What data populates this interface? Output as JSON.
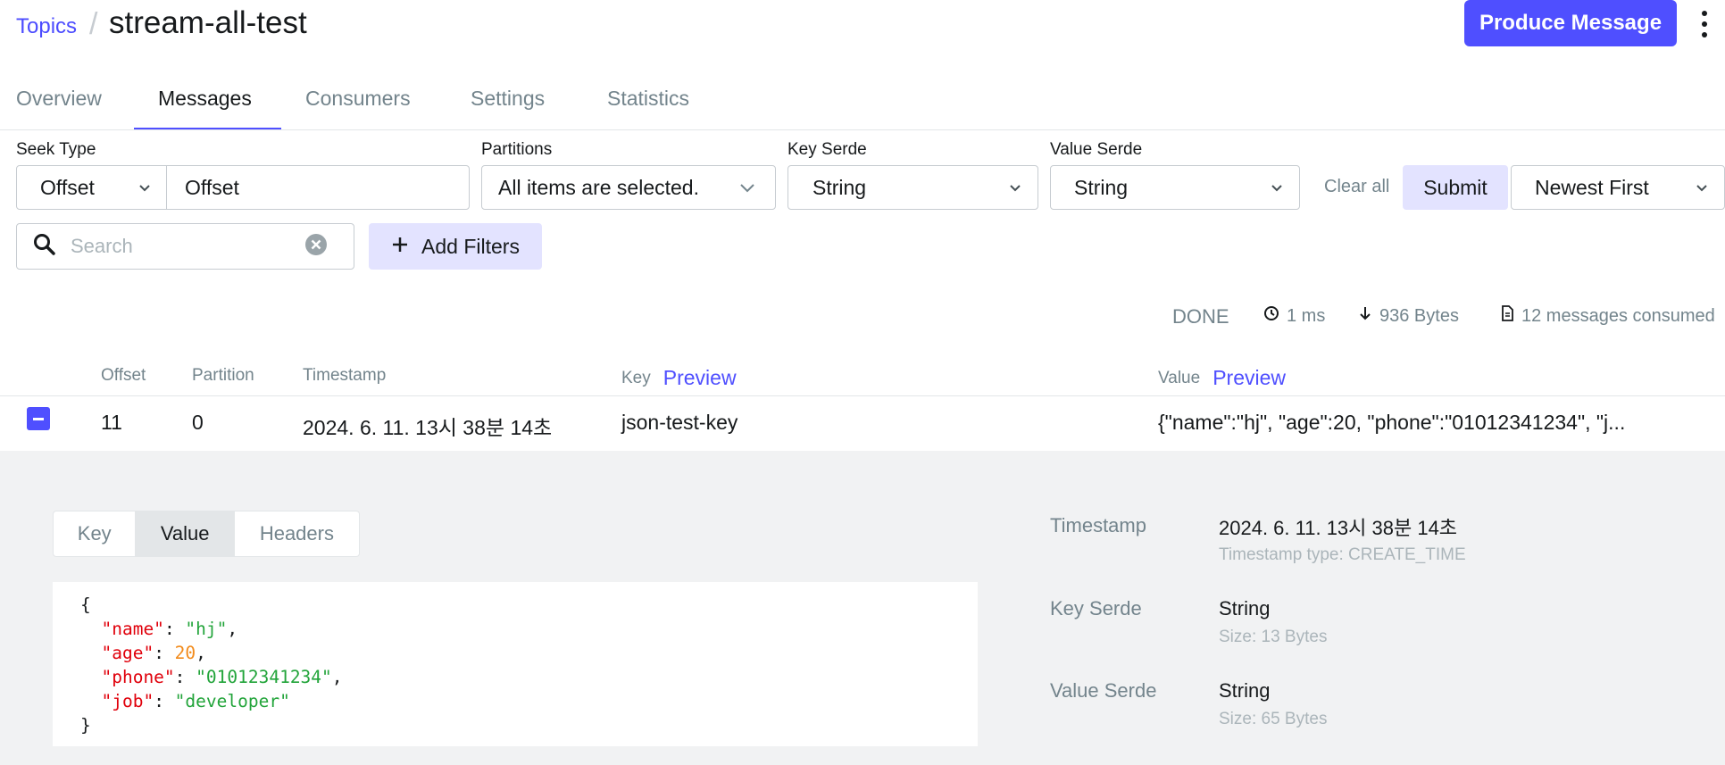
{
  "breadcrumb": {
    "parent": "Topics",
    "separator": "/",
    "title": "stream-all-test"
  },
  "header": {
    "produce_label": "Produce Message"
  },
  "tabs": [
    {
      "label": "Overview"
    },
    {
      "label": "Messages"
    },
    {
      "label": "Consumers"
    },
    {
      "label": "Settings"
    },
    {
      "label": "Statistics"
    }
  ],
  "active_tab": "Messages",
  "filters": {
    "seek_type_label": "Seek Type",
    "seek_type_value": "Offset",
    "seek_input_value": "Offset",
    "partitions_label": "Partitions",
    "partitions_value": "All items are selected.",
    "key_serde_label": "Key Serde",
    "key_serde_value": "String",
    "value_serde_label": "Value Serde",
    "value_serde_value": "String",
    "clear_all_label": "Clear all",
    "submit_label": "Submit",
    "order_value": "Newest First",
    "search_placeholder": "Search",
    "add_filters_label": "Add Filters"
  },
  "status": {
    "state": "DONE",
    "elapsed": "1 ms",
    "bytes": "936 Bytes",
    "messages": "12 messages consumed"
  },
  "table": {
    "headers": {
      "offset": "Offset",
      "partition": "Partition",
      "timestamp": "Timestamp",
      "key": "Key",
      "value": "Value",
      "preview": "Preview"
    },
    "rows": [
      {
        "offset": "11",
        "partition": "0",
        "timestamp": "2024. 6. 11. 13시 38분 14초",
        "key": "json-test-key",
        "value": "{\"name\":\"hj\", \"age\":20, \"phone\":\"01012341234\", \"j..."
      }
    ]
  },
  "details": {
    "subtabs": [
      "Key",
      "Value",
      "Headers"
    ],
    "active_subtab": "Value",
    "json": {
      "open": "{",
      "close": "}",
      "fields": [
        {
          "key": "\"name\"",
          "value": "\"hj\"",
          "type": "string"
        },
        {
          "key": "\"age\"",
          "value": "20",
          "type": "number"
        },
        {
          "key": "\"phone\"",
          "value": "\"01012341234\"",
          "type": "string"
        },
        {
          "key": "\"job\"",
          "value": "\"developer\"",
          "type": "string"
        }
      ]
    },
    "meta": {
      "timestamp_label": "Timestamp",
      "timestamp_value": "2024. 6. 11. 13시 38분 14초",
      "timestamp_type": "Timestamp type: CREATE_TIME",
      "key_serde_label": "Key Serde",
      "key_serde_value": "String",
      "key_size": "Size: 13 Bytes",
      "value_serde_label": "Value Serde",
      "value_serde_value": "String",
      "value_size": "Size: 65 Bytes"
    }
  },
  "colors": {
    "accent": "#4f4fff",
    "accent_soft": "#e3e3ff",
    "json_key": "#e0000b",
    "json_string": "#22a43a",
    "json_number": "#f28b1c"
  }
}
